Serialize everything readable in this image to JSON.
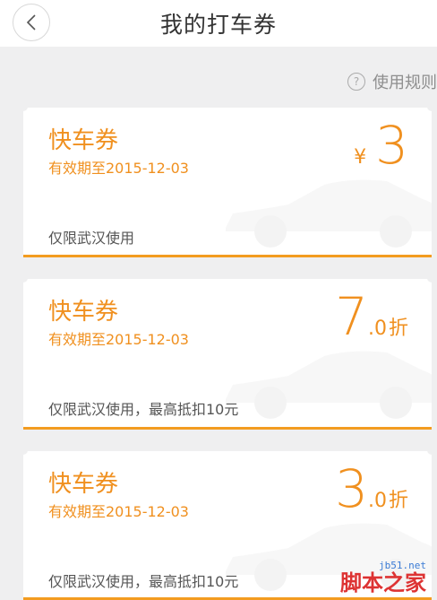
{
  "header": {
    "title": "我的打车券",
    "back_icon": "chevron-left-icon"
  },
  "rules": {
    "icon": "?",
    "label": "使用规则"
  },
  "coupons": [
    {
      "name": "快车券",
      "expiry": "有效期至2015-12-03",
      "limit": "仅限武汉使用",
      "currency": "¥",
      "amount_big": "3",
      "amount_decimal": "",
      "unit": ""
    },
    {
      "name": "快车券",
      "expiry": "有效期至2015-12-03",
      "limit": "仅限武汉使用，最高抵扣10元",
      "currency": "",
      "amount_big": "7",
      "amount_decimal": ".0",
      "unit": "折"
    },
    {
      "name": "快车券",
      "expiry": "有效期至2015-12-03",
      "limit": "仅限武汉使用，最高抵扣10元",
      "currency": "",
      "amount_big": "3",
      "amount_decimal": ".0",
      "unit": "折"
    }
  ],
  "watermark": {
    "site": "jb51.net",
    "name": "脚本之家"
  },
  "colors": {
    "accent": "#f0901f",
    "accent_line": "#f39c20",
    "background": "#efeff0"
  }
}
